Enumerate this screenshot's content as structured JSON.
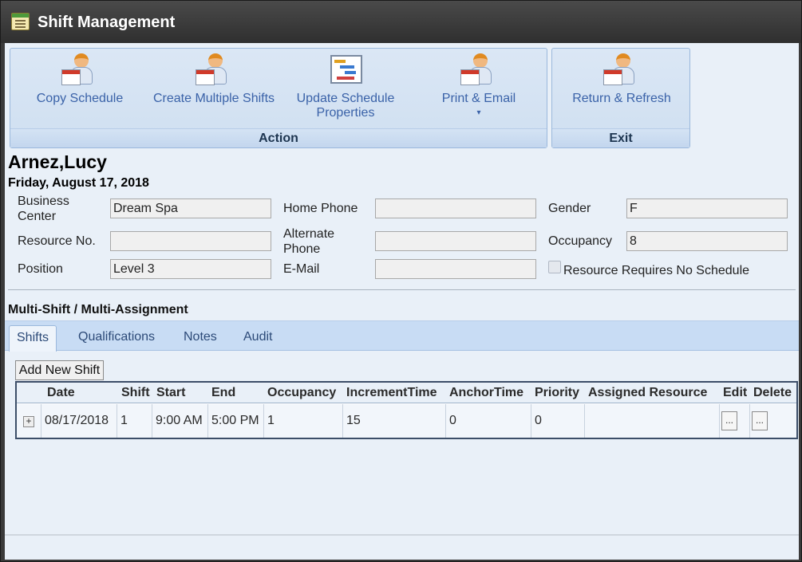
{
  "window": {
    "title": "Shift Management"
  },
  "ribbon": {
    "action_group": {
      "caption": "Action",
      "buttons": [
        {
          "label": "Copy Schedule",
          "icon": "schedule-person-icon"
        },
        {
          "label": "Create Multiple Shifts",
          "icon": "schedule-person-icon"
        },
        {
          "label": "Update Schedule Properties",
          "icon": "gantt-chart-icon"
        },
        {
          "label": "Print & Email",
          "icon": "schedule-person-icon",
          "has_dropdown": true,
          "dropdown_glyph": "▾"
        }
      ]
    },
    "exit_group": {
      "caption": "Exit",
      "buttons": [
        {
          "label": "Return & Refresh",
          "icon": "schedule-person-icon"
        }
      ]
    }
  },
  "resource": {
    "name": "Arnez,Lucy",
    "date": "Friday, August 17, 2018",
    "fields": {
      "business_center": {
        "label": "Business Center",
        "value": "Dream Spa"
      },
      "resource_no": {
        "label": "Resource No.",
        "value": ""
      },
      "position": {
        "label": "Position",
        "value": "Level 3"
      },
      "home_phone": {
        "label": "Home Phone",
        "value": ""
      },
      "alternate_phone": {
        "label": "Alternate Phone",
        "value": ""
      },
      "email": {
        "label": "E-Mail",
        "value": ""
      },
      "gender": {
        "label": "Gender",
        "value": "F"
      },
      "occupancy": {
        "label": "Occupancy",
        "value": "8"
      }
    },
    "no_schedule_checkbox": {
      "label": "Resource Requires No Schedule",
      "checked": false
    }
  },
  "multi_shift": {
    "title": "Multi-Shift / Multi-Assignment",
    "tabs": [
      "Shifts",
      "Qualifications",
      "Notes",
      "Audit"
    ],
    "active_tab": "Shifts",
    "add_button": "Add New Shift",
    "columns": [
      "Date",
      "Shift",
      "Start",
      "End",
      "Occupancy",
      "IncrementTime",
      "AnchorTime",
      "Priority",
      "Assigned Resource",
      "Edit",
      "Delete"
    ],
    "rows": [
      {
        "expander": "+",
        "date": "08/17/2018",
        "shift": "1",
        "start": "9:00 AM",
        "end": "5:00 PM",
        "occupancy": "1",
        "increment_time": "15",
        "anchor_time": "0",
        "priority": "0",
        "assigned_resource": "",
        "edit": "...",
        "delete": "..."
      }
    ]
  },
  "colors": {
    "accent": "#3a62a8",
    "title_bar": "#3a3a3a",
    "panel": "#e9f0f8"
  }
}
